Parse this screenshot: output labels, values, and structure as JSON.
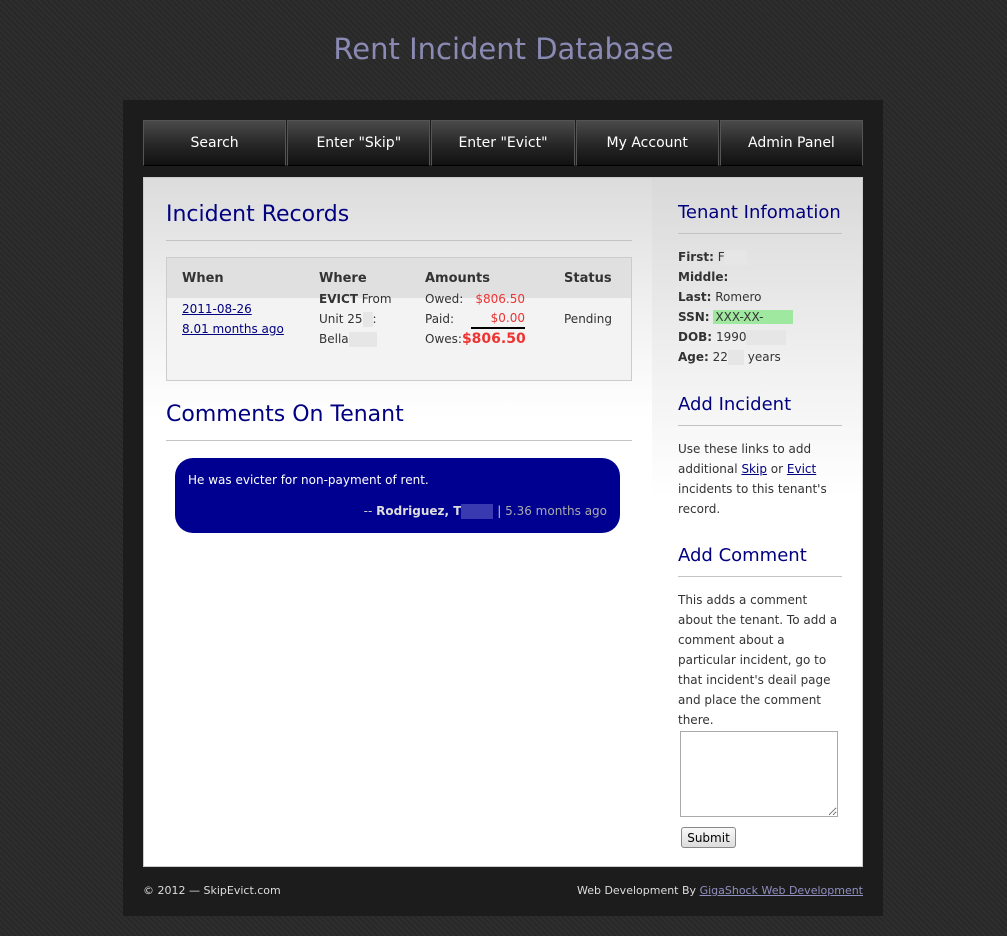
{
  "site_title": "Rent Incident Database",
  "nav": [
    "Search",
    "Enter \"Skip\"",
    "Enter \"Evict\"",
    "My Account",
    "Admin Panel"
  ],
  "records": {
    "title": "Incident Records",
    "headers": [
      "When",
      "Where",
      "Amounts",
      "Status"
    ],
    "row": {
      "date": "2011-08-26",
      "ago": "8.01 months ago",
      "type": "EVICT",
      "from": "From",
      "unit": "Unit 25",
      "unit_suffix": ":",
      "place": "Bella",
      "owed_label": "Owed:",
      "owed": "$806.50",
      "paid_label": "Paid:",
      "paid": "$0.00",
      "owes_label": "Owes:",
      "owes": "$806.50",
      "status": "Pending"
    }
  },
  "comments": {
    "title": "Comments On Tenant",
    "items": [
      {
        "text": "He was evicter for non-payment of rent.",
        "prefix": "--",
        "author": "Rodriguez, T",
        "separator": "|",
        "when": "5.36 months ago"
      }
    ]
  },
  "sidebar": {
    "tenant": {
      "title": "Tenant Infomation",
      "first_label": "First:",
      "first": "F",
      "middle_label": "Middle:",
      "middle": "",
      "last_label": "Last:",
      "last": "Romero",
      "ssn_label": "SSN:",
      "ssn": "XXX-XX-",
      "dob_label": "DOB:",
      "dob": "1990",
      "age_label": "Age:",
      "age": "22",
      "age_unit": "years"
    },
    "add_incident": {
      "title": "Add Incident",
      "text_before": "Use these links to add additional",
      "skip": "Skip",
      "or": "or",
      "evict": "Evict",
      "text_after": "incidents to this tenant's record."
    },
    "add_comment": {
      "title": "Add Comment",
      "text": "This adds a comment about the tenant. To add a comment about a particular incident, go to that incident's deail page and place the comment there.",
      "submit": "Submit"
    }
  },
  "footer": {
    "copyright": "© 2012 — SkipEvict.com",
    "dev_label": "Web Development By",
    "dev_link": "GigaShock Web Development"
  }
}
